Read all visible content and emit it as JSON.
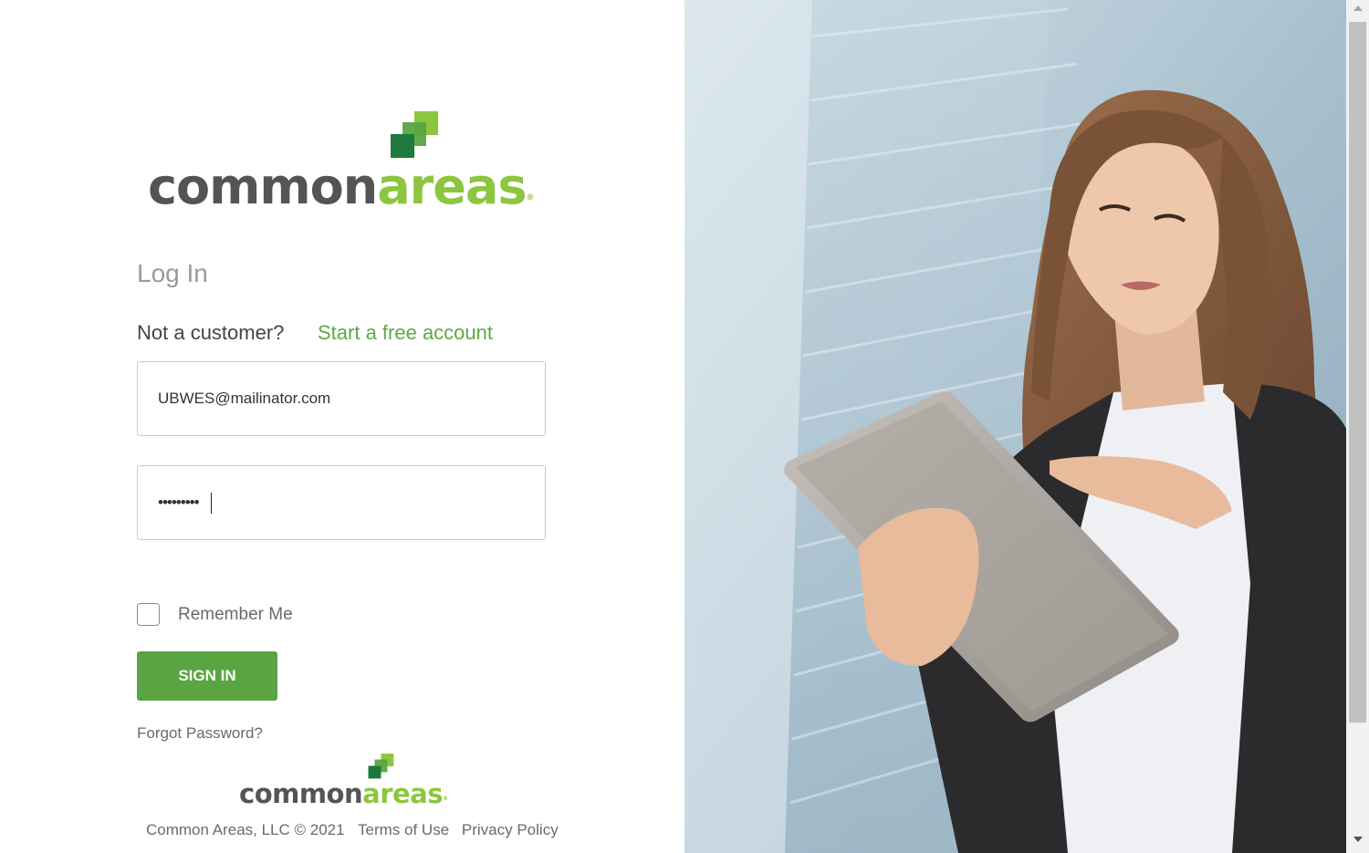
{
  "logo": {
    "word_common": "common",
    "word_areas": "areas",
    "mark_icon": "stacked-squares-logo-icon",
    "colors": {
      "gray": "#545454",
      "green_light": "#8cc63f",
      "green_mid": "#5aa442",
      "green_dark": "#1e7a3c"
    }
  },
  "login": {
    "title": "Log In",
    "not_customer_text": "Not a customer?",
    "start_account_link": "Start a free account",
    "email": {
      "value": "UBWES@mailinator.com"
    },
    "password": {
      "value": "•••••••••"
    },
    "remember_me_label": "Remember Me",
    "remember_me_checked": false,
    "sign_in_label": "SIGN IN",
    "forgot_password_link": "Forgot Password?"
  },
  "footer": {
    "copyright": "Common Areas, LLC © 2021",
    "terms_link": "Terms of Use",
    "privacy_link": "Privacy Policy"
  },
  "colors": {
    "accent": "#5aa442",
    "link": "#5fa845",
    "title_gray": "#9a9a9a"
  },
  "photo": {
    "description_icon": "woman-with-tablet-photo"
  }
}
